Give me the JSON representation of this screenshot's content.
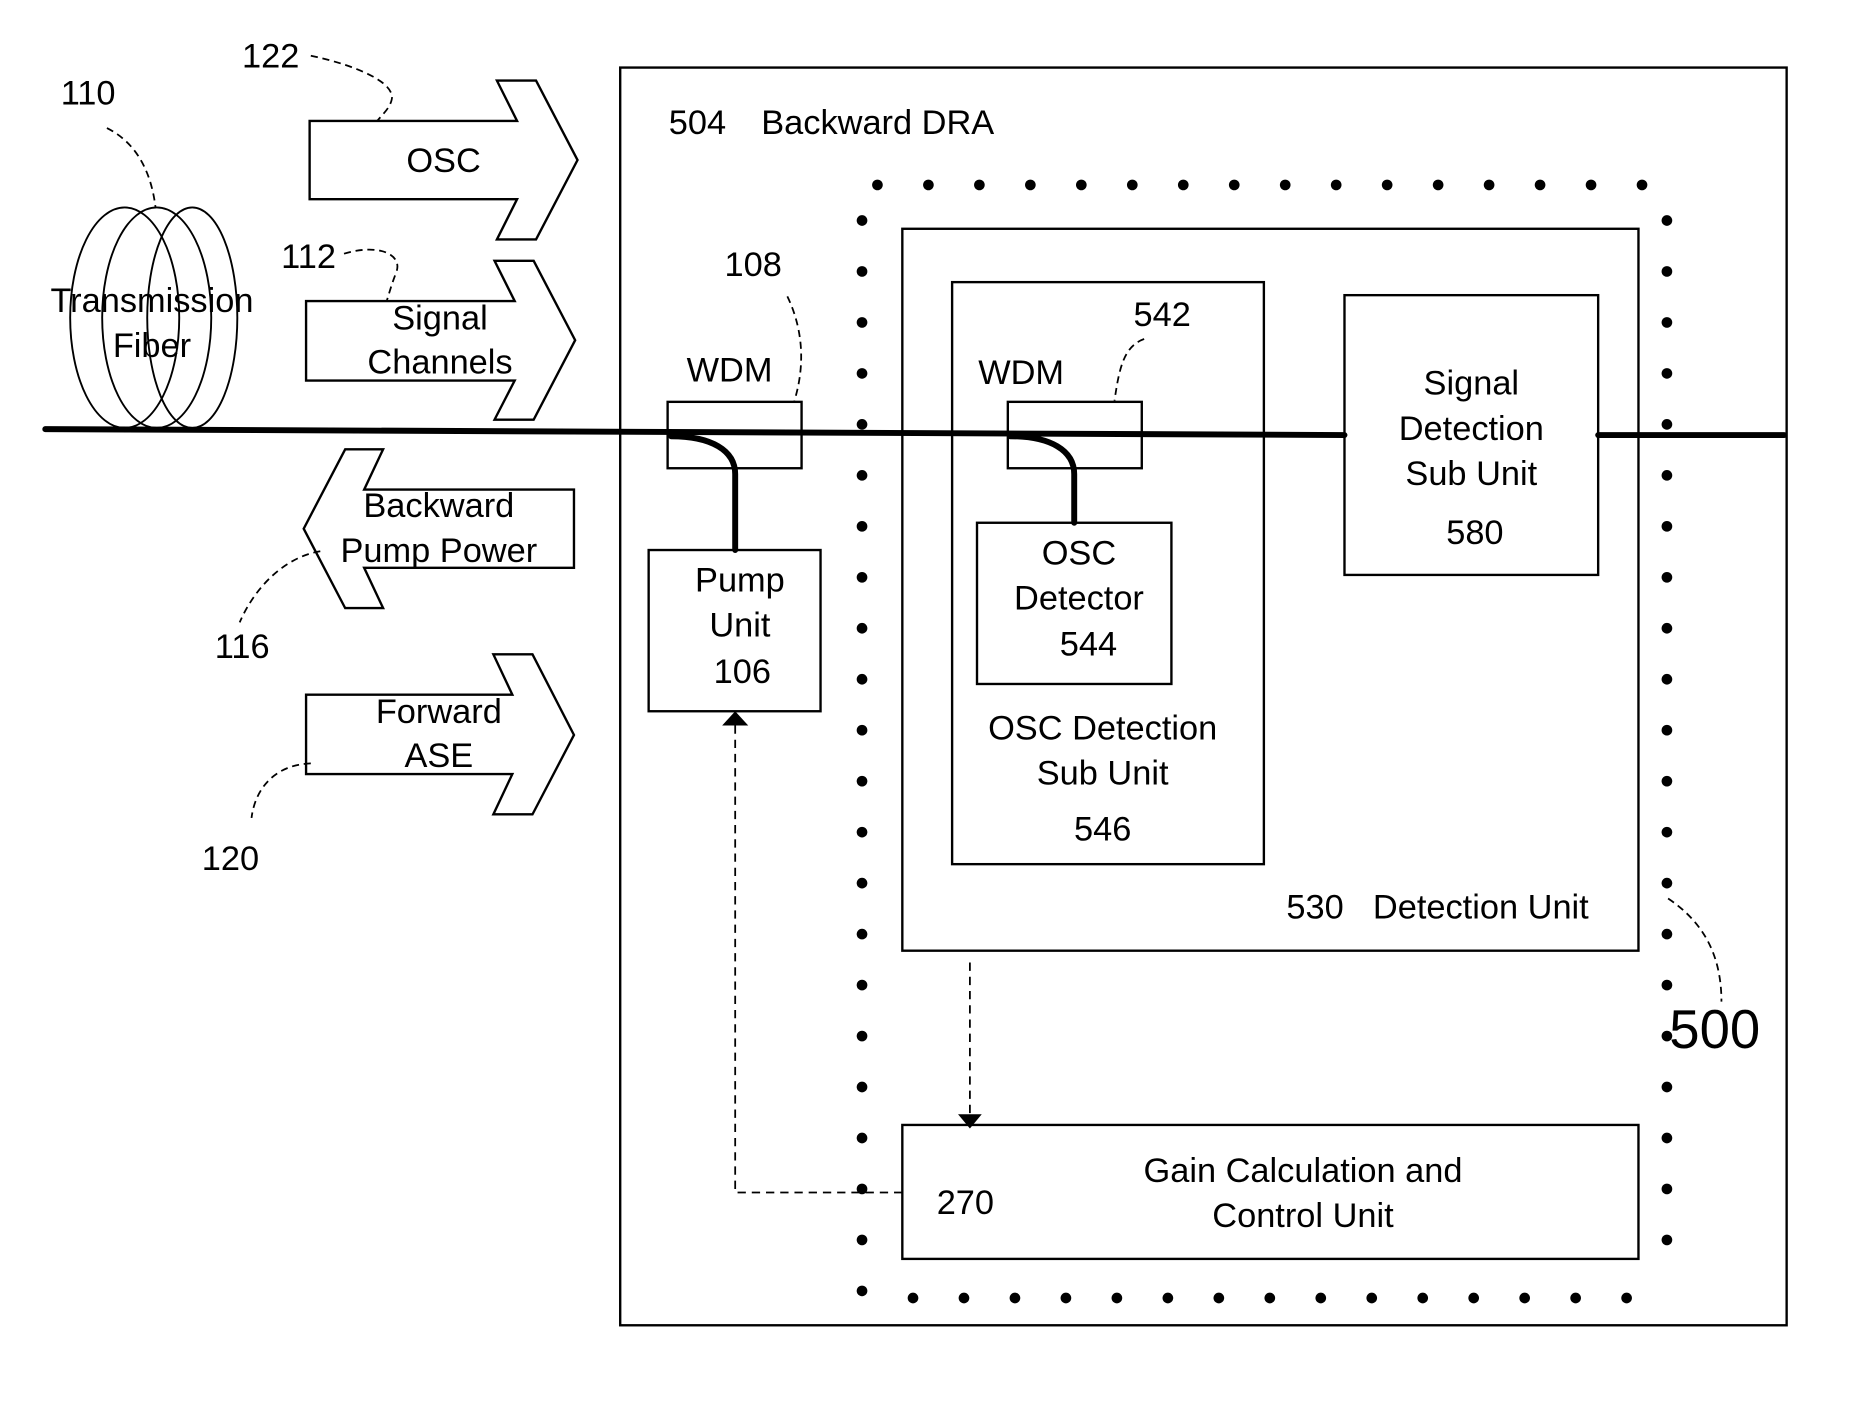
{
  "diagram": {
    "title_ref": "504",
    "title": "Backward DRA",
    "fiber": {
      "ref": "110",
      "label_line1": "Transmission",
      "label_line2": "Fiber"
    },
    "arrows": [
      {
        "ref": "122",
        "line1": "OSC",
        "line2": "",
        "direction": "right"
      },
      {
        "ref": "112",
        "line1": "Signal",
        "line2": "Channels",
        "direction": "right"
      },
      {
        "ref": "116",
        "line1": "Backward",
        "line2": "Pump Power",
        "direction": "left"
      },
      {
        "ref": "120",
        "line1": "Forward",
        "line2": "ASE",
        "direction": "right"
      }
    ],
    "wdm1": {
      "ref": "108",
      "label": "WDM"
    },
    "wdm2": {
      "ref": "542",
      "label": "WDM"
    },
    "pump_unit": {
      "line1": "Pump",
      "line2": "Unit",
      "ref": "106"
    },
    "osc_detector": {
      "line1": "OSC",
      "line2": "Detector",
      "ref": "544"
    },
    "osc_detection_sub_unit": {
      "line1": "OSC Detection",
      "line2": "Sub Unit",
      "ref": "546"
    },
    "signal_detection_sub_unit": {
      "line1": "Signal",
      "line2": "Detection",
      "line3": "Sub Unit",
      "ref": "580"
    },
    "detection_unit": {
      "ref": "530",
      "label": "Detection Unit"
    },
    "gain_unit": {
      "ref": "270",
      "line1": "Gain Calculation and",
      "line2": "Control Unit"
    },
    "dotted_group": {
      "ref": "500"
    }
  }
}
